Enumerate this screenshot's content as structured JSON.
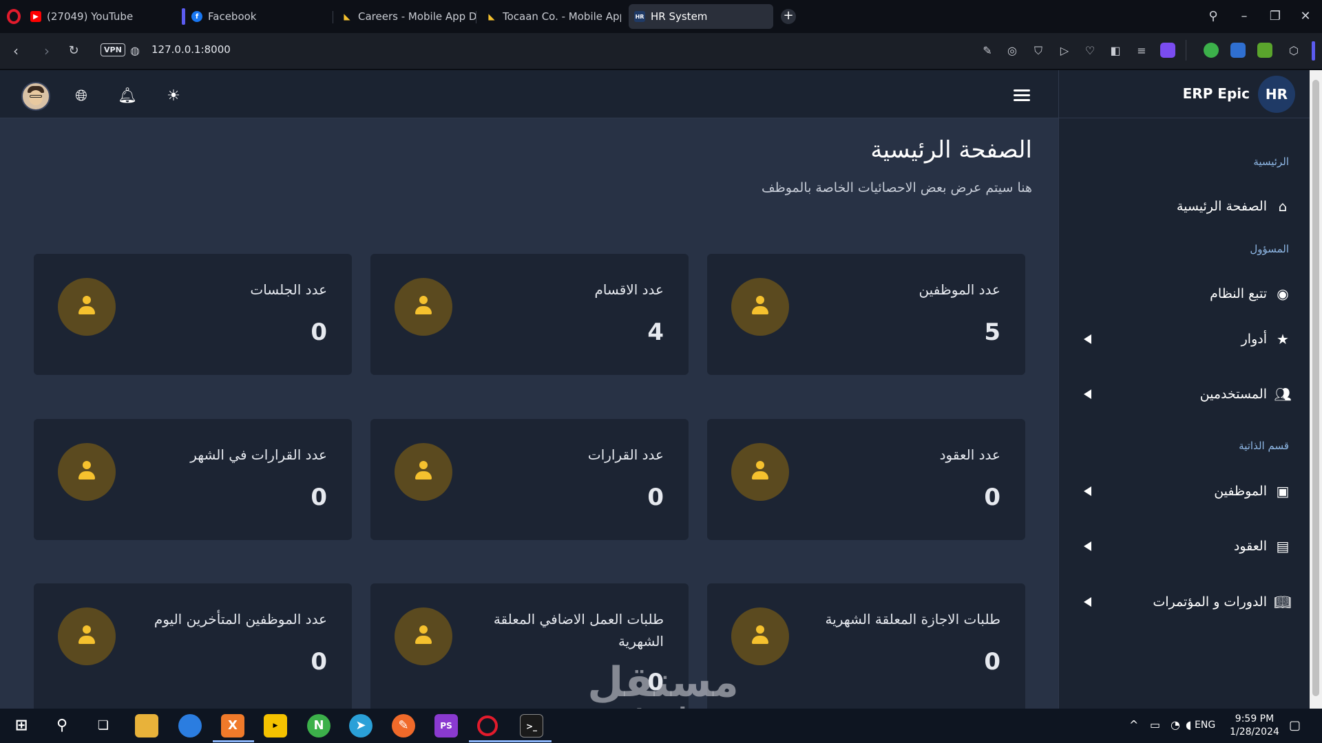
{
  "browser": {
    "tabs": [
      {
        "label": "(27049) YouTube",
        "favicon": "youtube-icon",
        "color": "#ff0000"
      },
      {
        "label": "Facebook",
        "favicon": "facebook-icon",
        "color": "#1877f2"
      },
      {
        "label": "Careers - Mobile App Dev",
        "favicon": "page-icon",
        "color": "#f5c12e"
      },
      {
        "label": "Tocaan Co. - Mobile App I",
        "favicon": "page-icon",
        "color": "#f5c12e"
      },
      {
        "label": "HR System",
        "favicon": "hr-icon",
        "color": "#1f3a66"
      }
    ],
    "url": "127.0.0.1:8000",
    "vpn_label": "VPN"
  },
  "app": {
    "brand_name": "ERP Epic",
    "brand_logo": "HR",
    "page_title": "الصفحة الرئيسية",
    "page_subtitle": "هنا سيتم عرض بعض الاحصائيات الخاصة بالموظف",
    "sidebar": {
      "sections": [
        {
          "title": "الرئيسية"
        },
        {
          "title": "المسؤول"
        },
        {
          "title": "قسم الذاتية"
        }
      ],
      "items": [
        {
          "label": "الصفحة الرئيسية",
          "icon": "home-icon"
        },
        {
          "label": "تتبع النظام",
          "icon": "fingerprint-icon"
        },
        {
          "label": "أدوار",
          "icon": "star-icon",
          "expandable": true
        },
        {
          "label": "المستخدمين",
          "icon": "users-icon",
          "expandable": true
        },
        {
          "label": "الموظفين",
          "icon": "id-badge-icon",
          "expandable": true
        },
        {
          "label": "العقود",
          "icon": "document-icon",
          "expandable": true
        },
        {
          "label": "الدورات و المؤتمرات",
          "icon": "book-icon",
          "expandable": true
        }
      ]
    },
    "stats": [
      {
        "title": "عدد الموظفين",
        "value": "5"
      },
      {
        "title": "عدد الاقسام",
        "value": "4"
      },
      {
        "title": "عدد الجلسات",
        "value": "0"
      },
      {
        "title": "عدد العقود",
        "value": "0"
      },
      {
        "title": "عدد القرارات",
        "value": "0"
      },
      {
        "title": "عدد القرارات في الشهر",
        "value": "0"
      },
      {
        "title": "طلبات الاجازة المعلقة الشهرية",
        "value": "0"
      },
      {
        "title": "طلبات العمل الاضافي المعلقة الشهرية",
        "value": "0"
      },
      {
        "title": "عدد الموظفين المتأخرين اليوم",
        "value": "0"
      }
    ]
  },
  "watermark": {
    "arabic": "مستقل",
    "latin": "mostaql.com"
  },
  "taskbar": {
    "language": "ENG",
    "time": "9:59 PM",
    "date": "1/28/2024"
  }
}
